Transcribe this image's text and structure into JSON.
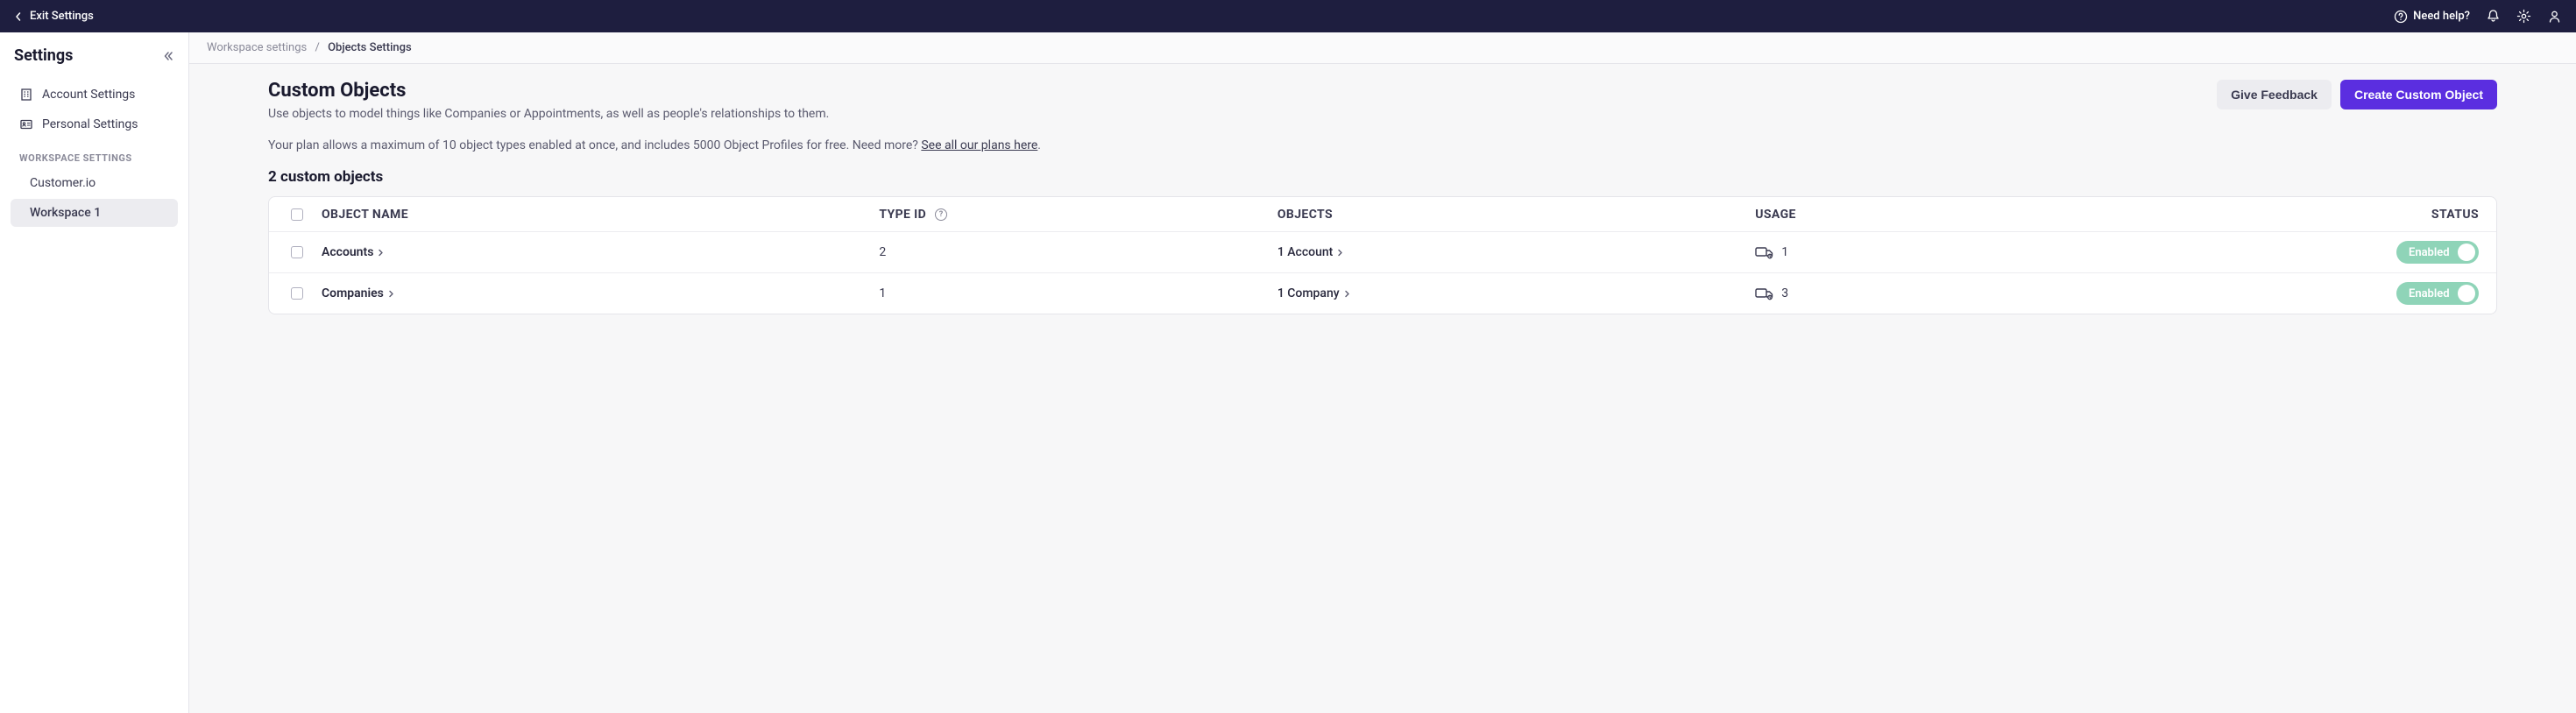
{
  "topbar": {
    "exit_label": "Exit Settings",
    "help_label": "Need help?"
  },
  "sidebar": {
    "title": "Settings",
    "items": [
      {
        "label": "Account Settings"
      },
      {
        "label": "Personal Settings"
      }
    ],
    "section_label": "WORKSPACE SETTINGS",
    "workspaces": [
      {
        "label": "Customer.io"
      },
      {
        "label": "Workspace 1"
      }
    ]
  },
  "breadcrumb": {
    "parent": "Workspace settings",
    "current": "Objects Settings"
  },
  "page": {
    "title": "Custom Objects",
    "subtitle": "Use objects to model things like Companies or Appointments, as well as people's relationships to them.",
    "feedback_label": "Give Feedback",
    "create_label": "Create Custom Object",
    "plan_note_prefix": "Your plan allows a maximum of 10 object types enabled at once, and includes 5000 Object Profiles for free. Need more? ",
    "plan_note_link": "See all our plans here",
    "plan_note_suffix": ".",
    "count_heading": "2 custom objects"
  },
  "table": {
    "columns": {
      "name": "OBJECT NAME",
      "type_id": "TYPE ID",
      "objects": "OBJECTS",
      "usage": "USAGE",
      "status": "STATUS"
    },
    "rows": [
      {
        "name": "Accounts",
        "type_id": "2",
        "objects_label": "1 Account",
        "usage": "1",
        "status_label": "Enabled"
      },
      {
        "name": "Companies",
        "type_id": "1",
        "objects_label": "1 Company",
        "usage": "3",
        "status_label": "Enabled"
      }
    ]
  }
}
